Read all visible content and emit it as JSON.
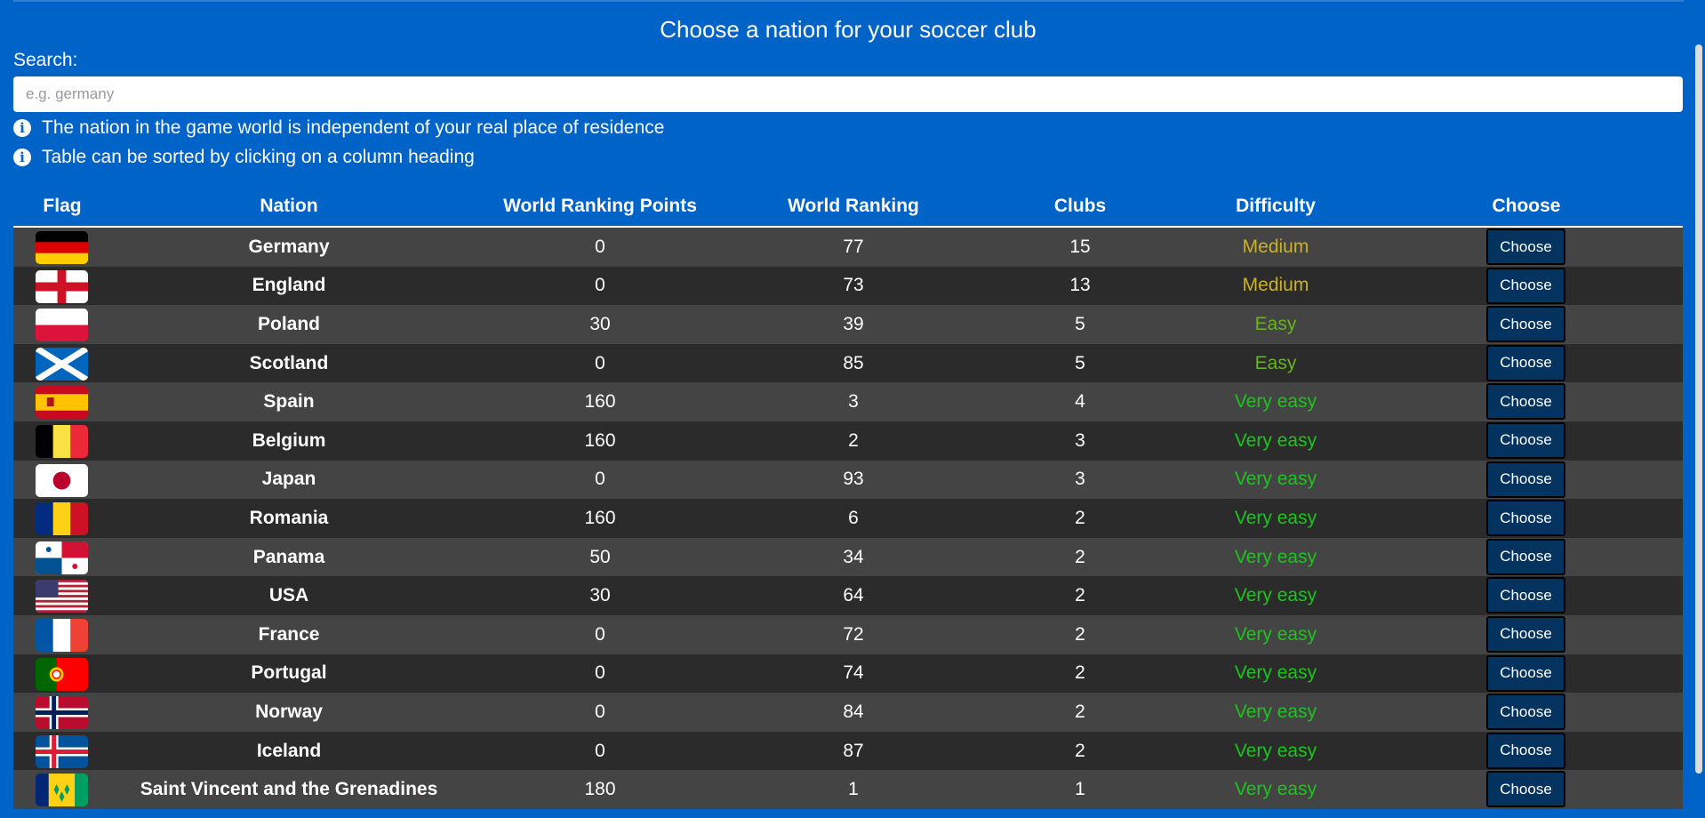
{
  "page": {
    "title": "Choose a nation for your soccer club",
    "search_label": "Search:",
    "search_placeholder": "e.g. germany",
    "info1": "The nation in the game world is independent of your real place of residence",
    "info2": "Table can be sorted by clicking on a column heading"
  },
  "colors": {
    "background": "#0063c7",
    "medium": "#c9b227",
    "easy": "#66b51d",
    "very_easy": "#1dc41d",
    "button": "#05335f"
  },
  "table": {
    "headers": [
      "Flag",
      "Nation",
      "World Ranking Points",
      "World Ranking",
      "Clubs",
      "Difficulty",
      "Choose"
    ],
    "choose_label": "Choose",
    "rows": [
      {
        "flag": "germany",
        "nation": "Germany",
        "points": "0",
        "ranking": "77",
        "clubs": "15",
        "difficulty": "Medium",
        "level": "medium"
      },
      {
        "flag": "england",
        "nation": "England",
        "points": "0",
        "ranking": "73",
        "clubs": "13",
        "difficulty": "Medium",
        "level": "medium"
      },
      {
        "flag": "poland",
        "nation": "Poland",
        "points": "30",
        "ranking": "39",
        "clubs": "5",
        "difficulty": "Easy",
        "level": "easy"
      },
      {
        "flag": "scotland",
        "nation": "Scotland",
        "points": "0",
        "ranking": "85",
        "clubs": "5",
        "difficulty": "Easy",
        "level": "easy"
      },
      {
        "flag": "spain",
        "nation": "Spain",
        "points": "160",
        "ranking": "3",
        "clubs": "4",
        "difficulty": "Very easy",
        "level": "very_easy"
      },
      {
        "flag": "belgium",
        "nation": "Belgium",
        "points": "160",
        "ranking": "2",
        "clubs": "3",
        "difficulty": "Very easy",
        "level": "very_easy"
      },
      {
        "flag": "japan",
        "nation": "Japan",
        "points": "0",
        "ranking": "93",
        "clubs": "3",
        "difficulty": "Very easy",
        "level": "very_easy"
      },
      {
        "flag": "romania",
        "nation": "Romania",
        "points": "160",
        "ranking": "6",
        "clubs": "2",
        "difficulty": "Very easy",
        "level": "very_easy"
      },
      {
        "flag": "panama",
        "nation": "Panama",
        "points": "50",
        "ranking": "34",
        "clubs": "2",
        "difficulty": "Very easy",
        "level": "very_easy"
      },
      {
        "flag": "usa",
        "nation": "USA",
        "points": "30",
        "ranking": "64",
        "clubs": "2",
        "difficulty": "Very easy",
        "level": "very_easy"
      },
      {
        "flag": "france",
        "nation": "France",
        "points": "0",
        "ranking": "72",
        "clubs": "2",
        "difficulty": "Very easy",
        "level": "very_easy"
      },
      {
        "flag": "portugal",
        "nation": "Portugal",
        "points": "0",
        "ranking": "74",
        "clubs": "2",
        "difficulty": "Very easy",
        "level": "very_easy"
      },
      {
        "flag": "norway",
        "nation": "Norway",
        "points": "0",
        "ranking": "84",
        "clubs": "2",
        "difficulty": "Very easy",
        "level": "very_easy"
      },
      {
        "flag": "iceland",
        "nation": "Iceland",
        "points": "0",
        "ranking": "87",
        "clubs": "2",
        "difficulty": "Very easy",
        "level": "very_easy"
      },
      {
        "flag": "saint-vincent",
        "nation": "Saint Vincent and the Grenadines",
        "points": "180",
        "ranking": "1",
        "clubs": "1",
        "difficulty": "Very easy",
        "level": "very_easy"
      }
    ]
  }
}
